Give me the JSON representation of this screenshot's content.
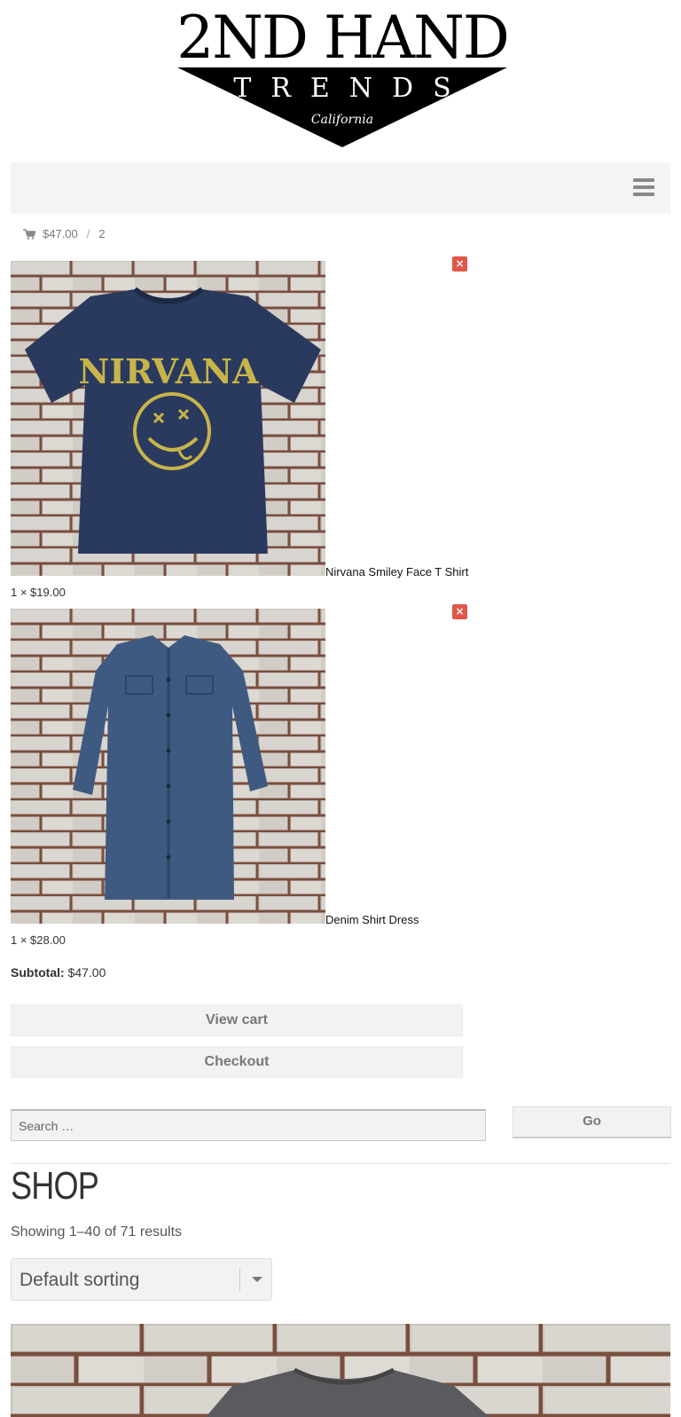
{
  "logo": {
    "brand": "2ND HAND",
    "tagline": "TRENDS",
    "location": "California"
  },
  "nav": {
    "menu_icon": "hamburger-icon"
  },
  "cart_summary": {
    "icon": "shopping-cart-icon",
    "total": "$47.00",
    "separator": "/",
    "count": "2"
  },
  "cart_items": [
    {
      "name": "Nirvana Smiley Face T Shirt",
      "qty_price": "1 × $19.00",
      "remove_icon": "remove-icon",
      "remove_label": "×"
    },
    {
      "name": "Denim Shirt Dress",
      "qty_price": "1 × $28.00",
      "remove_icon": "remove-icon",
      "remove_label": "×"
    }
  ],
  "subtotal": {
    "label": "Subtotal:",
    "value": "$47.00"
  },
  "buttons": {
    "view_cart": "View cart",
    "checkout": "Checkout"
  },
  "search": {
    "placeholder": "Search …",
    "go": "Go"
  },
  "shop": {
    "title": "SHOP",
    "results": "Showing 1–40 of 71 results",
    "sort_selected": "Default sorting"
  },
  "colors": {
    "remove_button": "#e2564a",
    "panel_bg": "#f4f4f4",
    "navy_shirt": "#2a3a5e",
    "denim": "#3e5a80"
  }
}
